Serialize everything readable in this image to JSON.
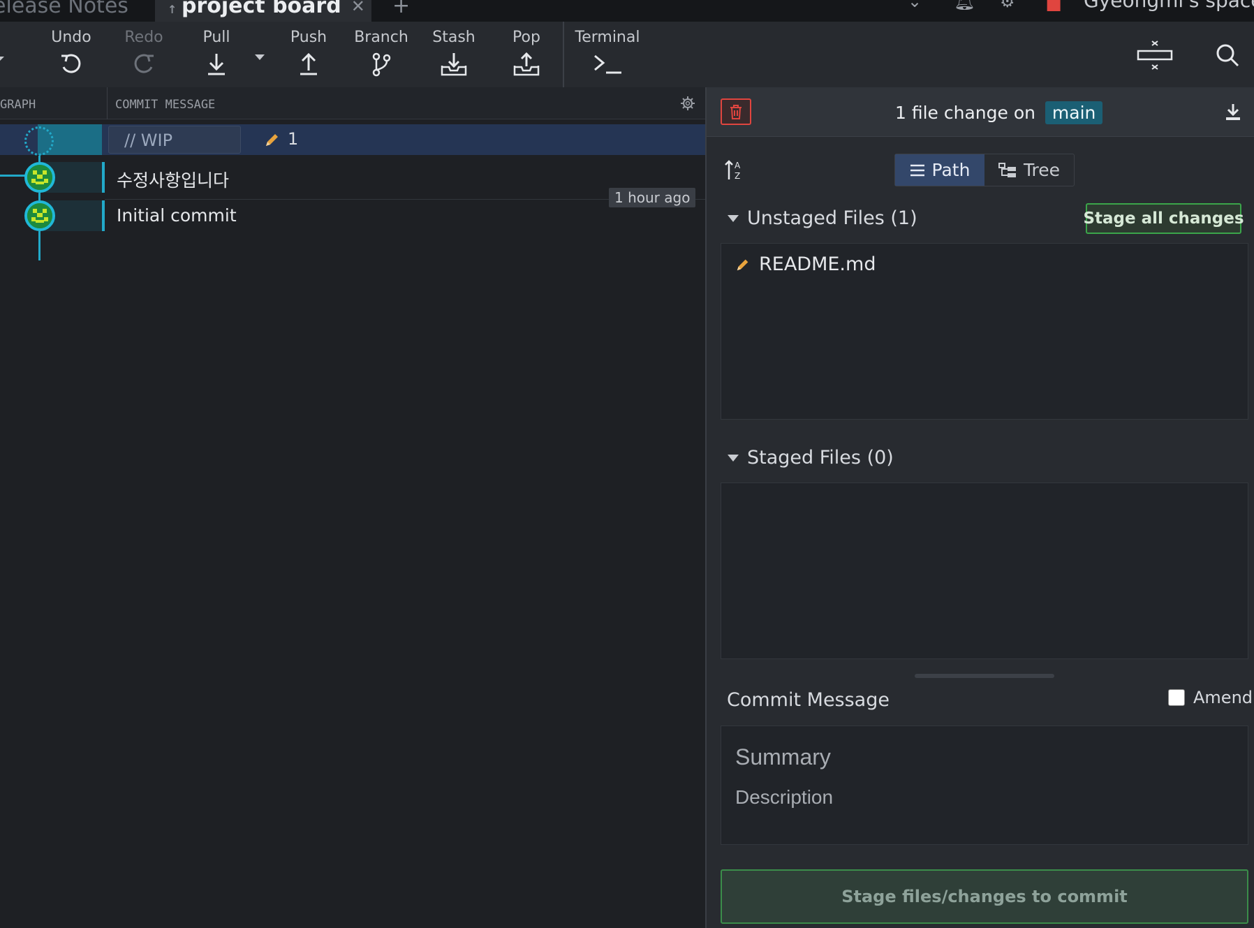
{
  "tabs": {
    "previous_tab": "elease Notes",
    "active_tab": "project board",
    "close_glyph": "✕",
    "add_glyph": "+",
    "workspace_name": "Gyeongmi's space"
  },
  "toolbar": {
    "undo": "Undo",
    "redo": "Redo",
    "pull": "Pull",
    "push": "Push",
    "branch": "Branch",
    "stash": "Stash",
    "pop": "Pop",
    "terminal": "Terminal"
  },
  "graph": {
    "header_graph": "GRAPH",
    "header_message": "COMMIT MESSAGE",
    "wip_label": "// WIP",
    "wip_count": "1",
    "commits": [
      {
        "message": "수정사항입니다"
      },
      {
        "message": "Initial commit"
      }
    ],
    "time_badge": "1 hour ago"
  },
  "changes": {
    "summary_prefix": "1 file change on",
    "branch": "main",
    "view_path": "Path",
    "view_tree": "Tree",
    "unstaged_title": "Unstaged Files (1)",
    "stage_all": "Stage all changes",
    "unstaged_files": [
      {
        "name": "README.md",
        "status": "modified"
      }
    ],
    "staged_title": "Staged Files (0)"
  },
  "commit": {
    "label": "Commit Message",
    "amend": "Amend",
    "summary_placeholder": "Summary",
    "description_placeholder": "Description",
    "button": "Stage files/changes to commit"
  },
  "colors": {
    "accent_teal": "#22a9c9",
    "stage_green": "#3ba54a",
    "discard_red": "#e0453f",
    "pencil_orange": "#e8a33d"
  },
  "icons": [
    "undo-icon",
    "redo-icon",
    "pull-icon",
    "push-icon",
    "branch-icon",
    "stash-icon",
    "pop-icon",
    "terminal-icon",
    "layout-icon",
    "search-icon",
    "gear-icon",
    "trash-icon",
    "download-icon",
    "sort-icon",
    "list-icon",
    "tree-icon",
    "pencil-icon",
    "bell-icon",
    "settings-icon"
  ]
}
